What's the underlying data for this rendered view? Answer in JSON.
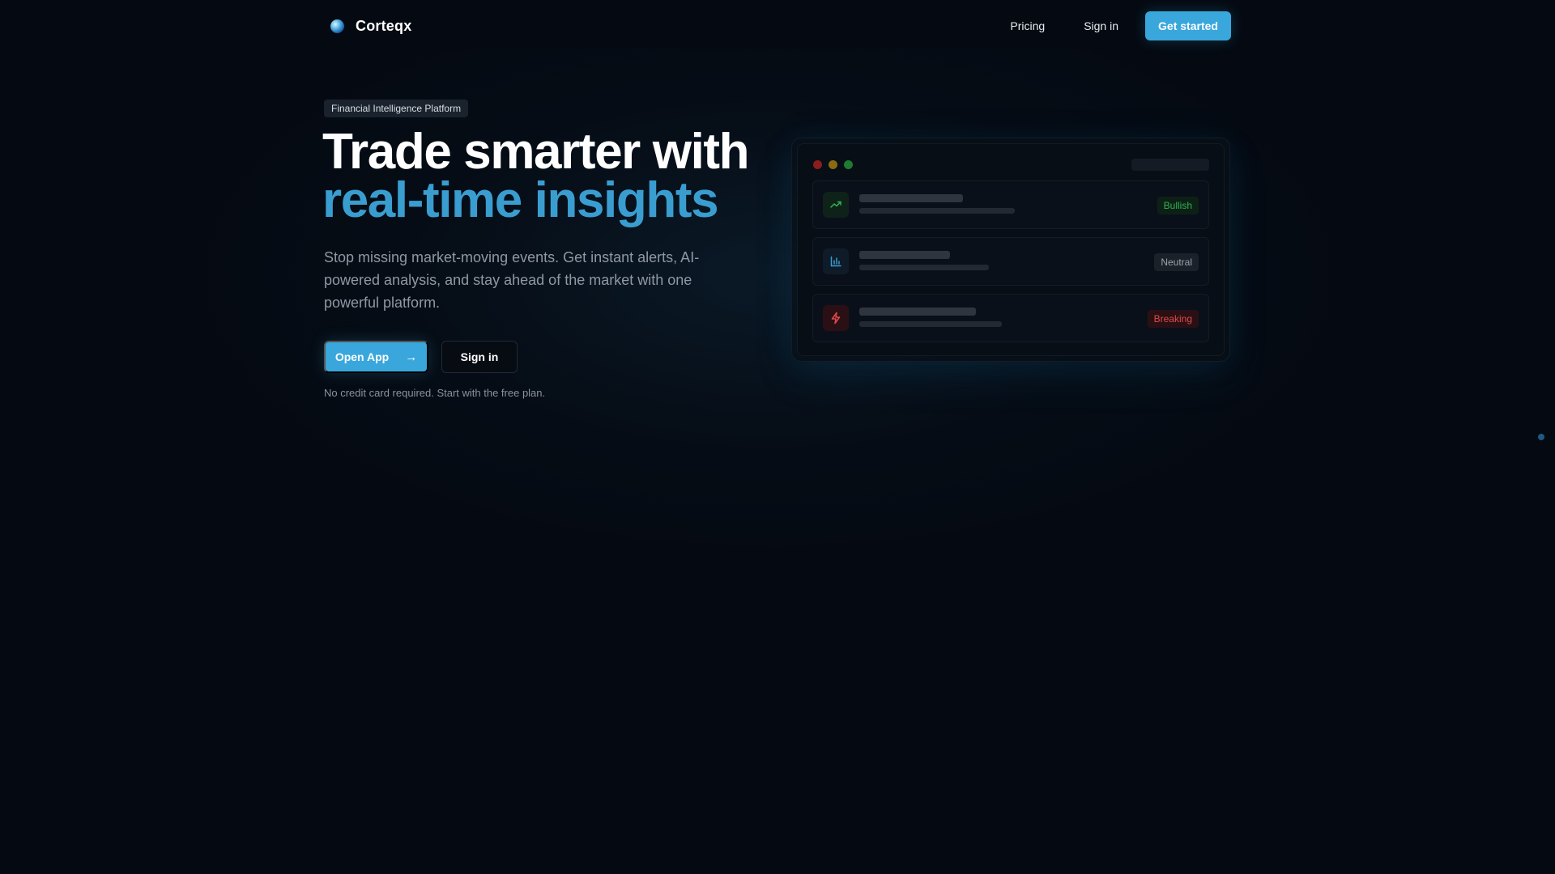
{
  "nav": {
    "brand": "Corteqx",
    "links": [
      "Pricing",
      "Sign in"
    ],
    "cta": "Get started"
  },
  "hero": {
    "badge": "Financial Intelligence Platform",
    "headline_line1": "Trade smarter with",
    "headline_line2": "real-time insights",
    "subtext": "Stop missing market-moving events. Get instant alerts, AI-powered analysis, and stay ahead of the market with one powerful platform.",
    "primary_cta": "Open App",
    "secondary_cta": "Sign in",
    "note": "No credit card required. Start with the free plan."
  },
  "preview": {
    "rows": [
      {
        "icon": "trending-up-icon",
        "tag": "Bullish"
      },
      {
        "icon": "bar-chart-icon",
        "tag": "Neutral"
      },
      {
        "icon": "lightning-icon",
        "tag": "Breaking"
      }
    ]
  },
  "colors": {
    "background": "#050a12",
    "accent": "#39a7dc",
    "headline_accent": "#3a9dd0",
    "bullish": "#2fb24f",
    "neutral": "#9aa2ac",
    "breaking": "#e04a4a"
  }
}
